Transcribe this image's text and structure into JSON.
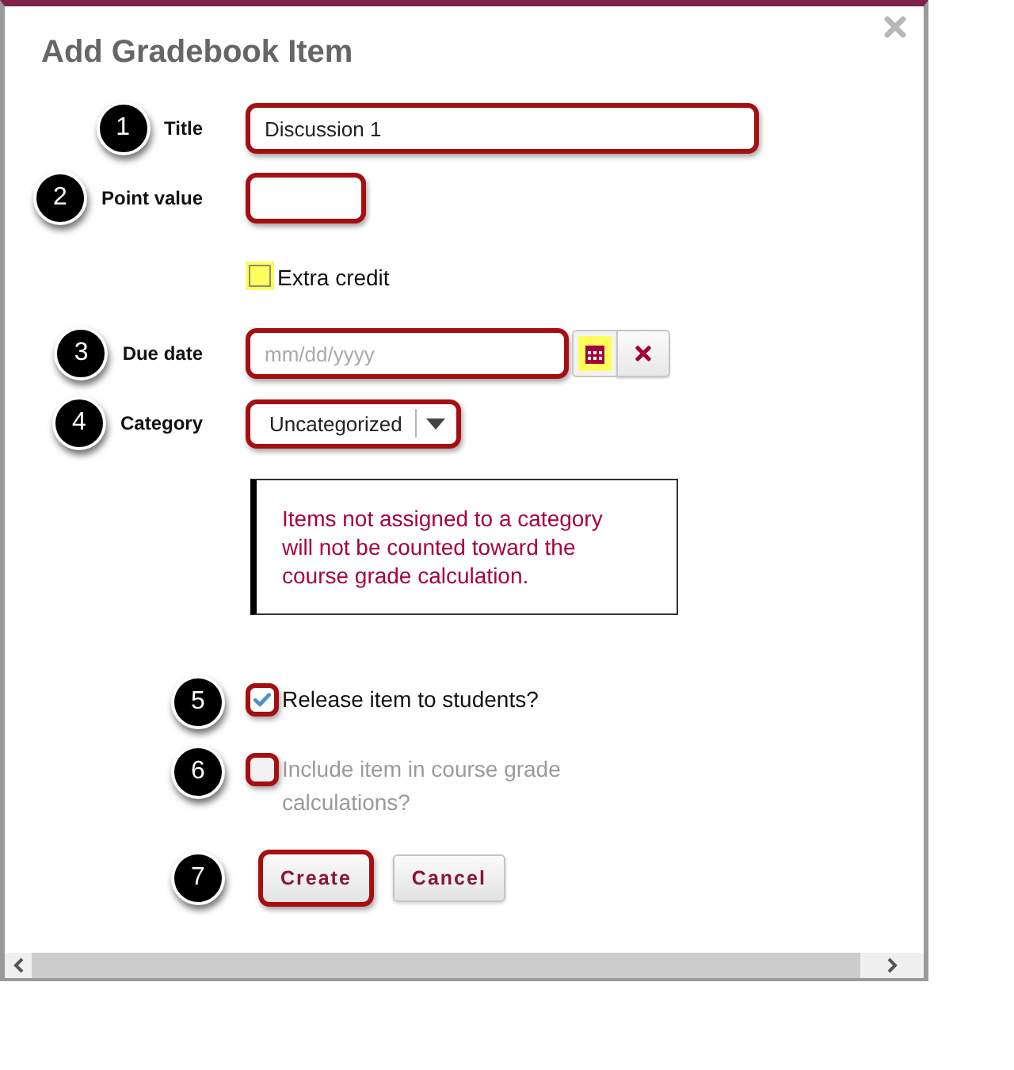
{
  "dialog": {
    "title": "Add Gradebook Item"
  },
  "fields": [
    {
      "kind": "text",
      "callout": "1",
      "label": "Title",
      "value": "Discussion 1",
      "outlined": true
    },
    {
      "kind": "number",
      "callout": "2",
      "label": "Point value",
      "outlined": true
    },
    {
      "kind": "checkbox",
      "label": "Extra credit",
      "checked": false,
      "disabled": false,
      "highlighted": true
    },
    {
      "kind": "date",
      "callout": "3",
      "label": "Due date",
      "placeholder": "mm/dd/yyyy",
      "outlined": true,
      "actions": [
        {
          "kind": "calendar",
          "highlighted": true
        },
        {
          "kind": "clear",
          "highlighted": false
        }
      ]
    },
    {
      "kind": "select",
      "callout": "4",
      "label": "Category",
      "value": "Uncategorized",
      "outlined": true
    },
    {
      "kind": "notice",
      "text": "Items not assigned to a category will not be counted toward the course grade calculation."
    },
    {
      "kind": "checkbox",
      "callout": "5",
      "label": "Release item to students?",
      "checked": true,
      "disabled": false,
      "outlined": true
    },
    {
      "kind": "checkbox",
      "callout": "6",
      "label": "Include item in course grade calculations?",
      "checked": false,
      "disabled": true,
      "outlined": true
    }
  ],
  "buttons": [
    {
      "callout": "7",
      "label": "Create",
      "outlined": true
    },
    {
      "label": "Cancel",
      "outlined": false
    }
  ]
}
